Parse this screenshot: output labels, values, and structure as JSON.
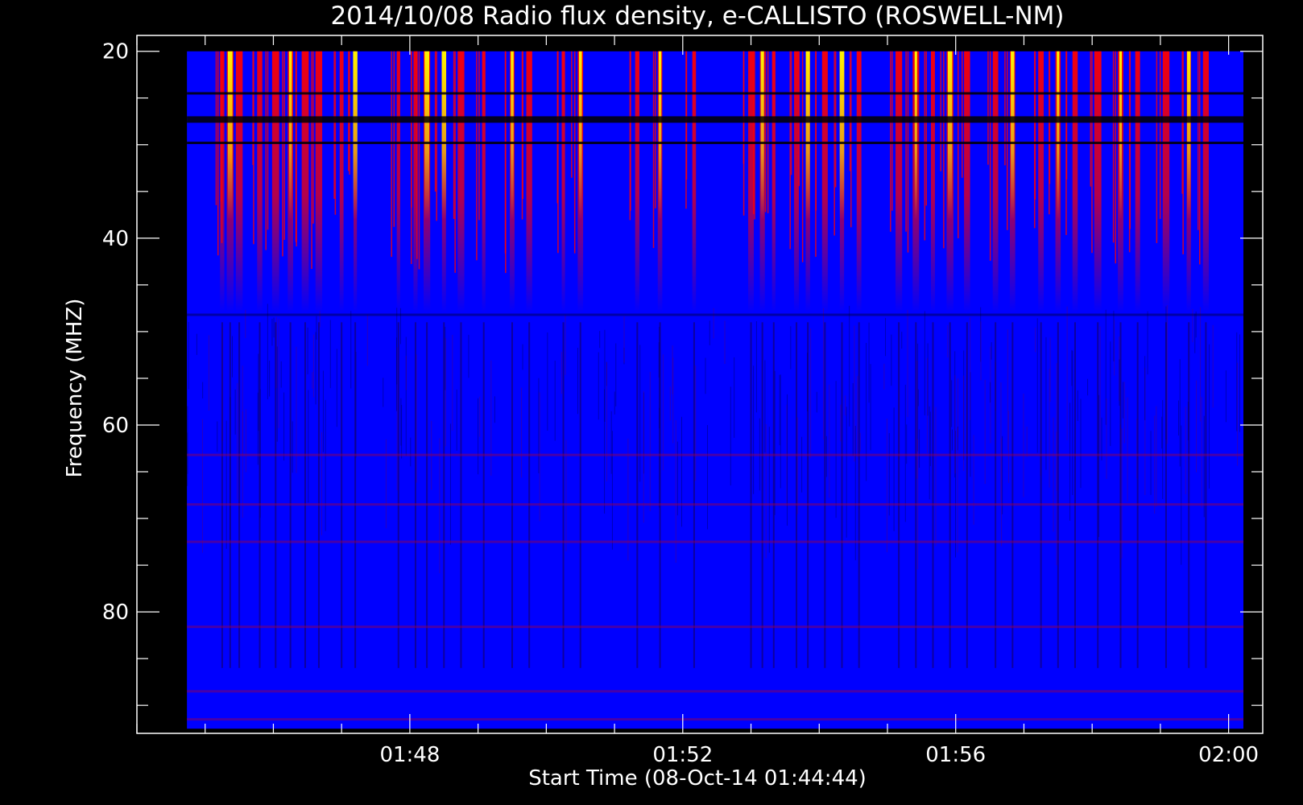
{
  "chart_data": {
    "type": "heatmap",
    "title": "2014/10/08  Radio flux density, e-CALLISTO (ROSWELL-NM)",
    "xlabel": "Start Time (08-Oct-14 01:44:44)",
    "ylabel": "Frequency (MHZ)",
    "x_unit": "minutes",
    "xlim": [
      "01:44:00",
      "02:00:30"
    ],
    "ylim": [
      93,
      18.3
    ],
    "data_x_range": [
      "01:44:44",
      "02:00:13"
    ],
    "data_y_range": [
      20,
      92.5
    ],
    "y_inverted": true,
    "x_ticks": [
      "01:48",
      "01:52",
      "01:56",
      "02:00"
    ],
    "y_ticks": [
      20,
      40,
      60,
      80
    ],
    "x_minor_step_minutes": 1,
    "y_minor_step": 5,
    "colors": {
      "background": "#0000ff",
      "low": "#000000",
      "mid": "#ff0000",
      "high": "#ffff00",
      "frame": "#ffffff"
    },
    "burst_times": [
      "01:45:15",
      "01:45:22",
      "01:45:30",
      "01:45:48",
      "01:46:02",
      "01:46:15",
      "01:46:28",
      "01:46:40",
      "01:47:00",
      "01:47:12",
      "01:47:50",
      "01:48:05",
      "01:48:15",
      "01:48:30",
      "01:48:45",
      "01:49:05",
      "01:49:30",
      "01:49:45",
      "01:50:15",
      "01:50:30",
      "01:51:20",
      "01:51:40",
      "01:52:10",
      "01:53:00",
      "01:53:10",
      "01:53:20",
      "01:53:40",
      "01:53:50",
      "01:54:05",
      "01:54:20",
      "01:54:35",
      "01:55:10",
      "01:55:25",
      "01:55:40",
      "01:55:55",
      "01:56:10",
      "01:56:35",
      "01:56:50",
      "01:57:15",
      "01:57:30",
      "01:57:45",
      "01:58:05",
      "01:58:25",
      "01:58:40",
      "01:59:05",
      "01:59:25",
      "01:59:40"
    ],
    "bright_burst_times": [
      "01:45:22",
      "01:46:15",
      "01:47:12",
      "01:48:15",
      "01:48:30",
      "01:49:30",
      "01:50:30",
      "01:51:40",
      "01:53:10",
      "01:53:50",
      "01:54:20",
      "01:55:25",
      "01:55:55",
      "01:56:50",
      "01:57:30",
      "01:58:25",
      "01:59:25"
    ],
    "dark_band_frequencies": [
      24.5,
      27.3,
      29.8,
      48.2
    ],
    "rfi_band_frequencies": [
      63.2,
      68.5,
      72.5,
      81.6,
      88.5,
      91.5
    ]
  }
}
